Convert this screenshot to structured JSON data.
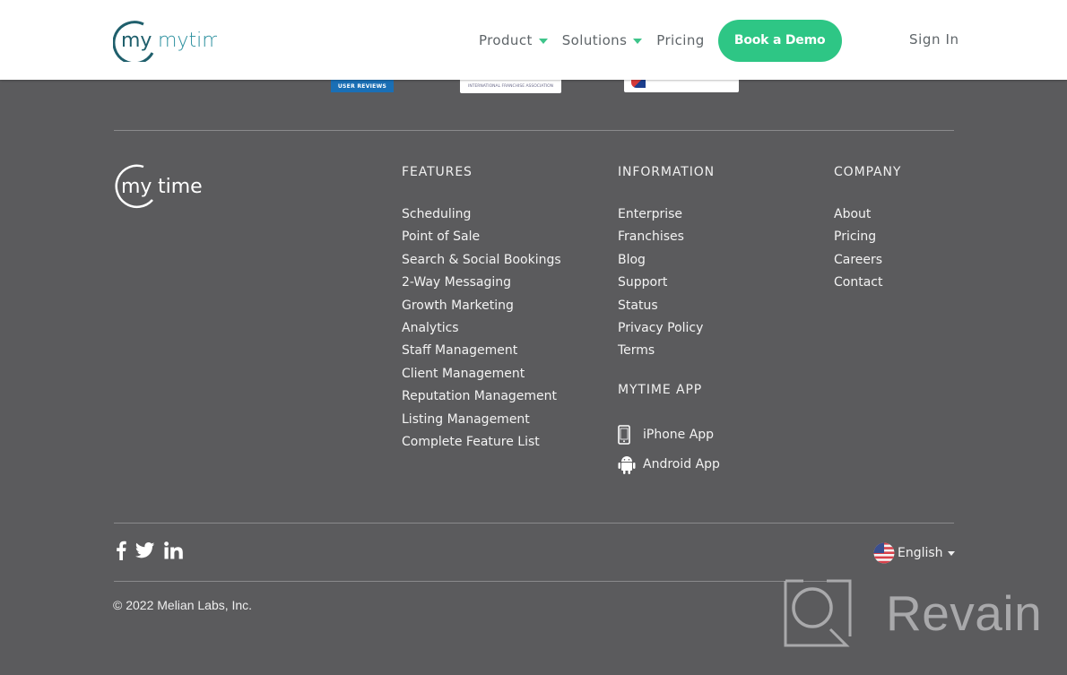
{
  "header": {
    "logo_text": "mytime",
    "nav": [
      {
        "label": "Product",
        "has_dropdown": true
      },
      {
        "label": "Solutions",
        "has_dropdown": true
      },
      {
        "label": "Pricing",
        "has_dropdown": false
      }
    ],
    "cta_label": "Book a Demo",
    "signin_label": "Sign In",
    "accent_color": "#2ec685"
  },
  "badges": {
    "g2_label": "USER REVIEWS",
    "ifa_label": "INTERNATIONAL FRANCHISE ASSOCIATION"
  },
  "footer": {
    "logo_text": "mytime",
    "features": {
      "title": "FEATURES",
      "items": [
        "Scheduling",
        "Point of Sale",
        "Search & Social Bookings",
        "2-Way Messaging",
        "Growth Marketing",
        "Analytics",
        "Staff Management",
        "Client Management",
        "Reputation Management",
        "Listing Management",
        "Complete Feature List"
      ]
    },
    "information": {
      "title": "INFORMATION",
      "items": [
        "Enterprise",
        "Franchises",
        "Blog",
        "Support",
        "Status",
        "Privacy Policy",
        "Terms"
      ]
    },
    "app": {
      "title": "MYTIME APP",
      "items": [
        {
          "label": "iPhone App",
          "icon": "iphone-icon"
        },
        {
          "label": "Android App",
          "icon": "android-icon"
        }
      ]
    },
    "company": {
      "title": "COMPANY",
      "items": [
        "About",
        "Pricing",
        "Careers",
        "Contact"
      ]
    },
    "social": [
      "facebook-icon",
      "twitter-icon",
      "linkedin-icon"
    ],
    "language": "English",
    "copyright": "© 2022 Melian Labs, Inc."
  },
  "watermark": {
    "text": "Revain"
  }
}
